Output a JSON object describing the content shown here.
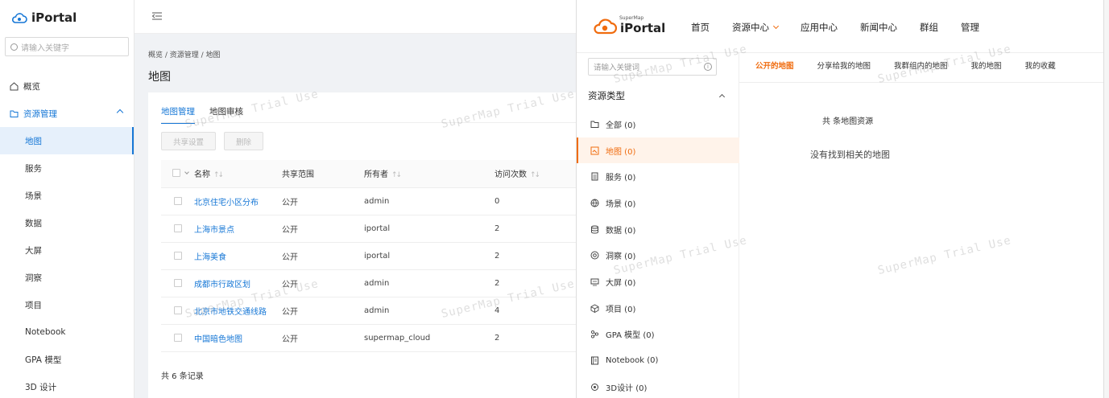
{
  "left": {
    "logo": "iPortal",
    "search_placeholder": "请输入关键字",
    "nav": {
      "overview": "概览",
      "resource_mgmt": "资源管理",
      "sub_items": [
        "地图",
        "服务",
        "场景",
        "数据",
        "大屏",
        "洞察",
        "项目",
        "Notebook",
        "GPA 模型",
        "3D 设计"
      ]
    },
    "breadcrumb": "概览 / 资源管理 / 地图",
    "page_title": "地图",
    "tabs": [
      "地图管理",
      "地图审核"
    ],
    "buttons": {
      "share": "共享设置",
      "delete": "删除"
    },
    "table": {
      "headers": [
        "名称",
        "共享范围",
        "所有者",
        "访问次数"
      ],
      "rows": [
        [
          "北京住宅小区分布",
          "公开",
          "admin",
          "0"
        ],
        [
          "上海市景点",
          "公开",
          "iportal",
          "2"
        ],
        [
          "上海美食",
          "公开",
          "iportal",
          "2"
        ],
        [
          "成都市行政区划",
          "公开",
          "admin",
          "2"
        ],
        [
          "北京市地铁交通线路",
          "公开",
          "admin",
          "4"
        ],
        [
          "中国暗色地图",
          "公开",
          "supermap_cloud",
          "2"
        ]
      ]
    },
    "total": "共 6 条记录"
  },
  "right": {
    "logo_small": "SuperMap",
    "logo": "iPortal",
    "top_nav": [
      "首页",
      "资源中心",
      "应用中心",
      "新闻中心",
      "群组",
      "管理"
    ],
    "search_placeholder": "请输入关键词",
    "resource_type": "资源类型",
    "types": [
      "全部 (0)",
      "地图 (0)",
      "服务 (0)",
      "场景 (0)",
      "数据 (0)",
      "洞察 (0)",
      "大屏 (0)",
      "项目 (0)",
      "GPA 模型 (0)",
      "Notebook (0)",
      "3D设计 (0)"
    ],
    "tabs": [
      "公开的地图",
      "分享给我的地图",
      "我群组内的地图",
      "我的地图",
      "我的收藏"
    ],
    "count_text": "共 条地图资源",
    "empty_text": "没有找到相关的地图"
  },
  "watermark": "SuperMap Trial Use",
  "colors": {
    "admin_accent": "#1677d6",
    "portal_accent": "#f06c0f"
  }
}
